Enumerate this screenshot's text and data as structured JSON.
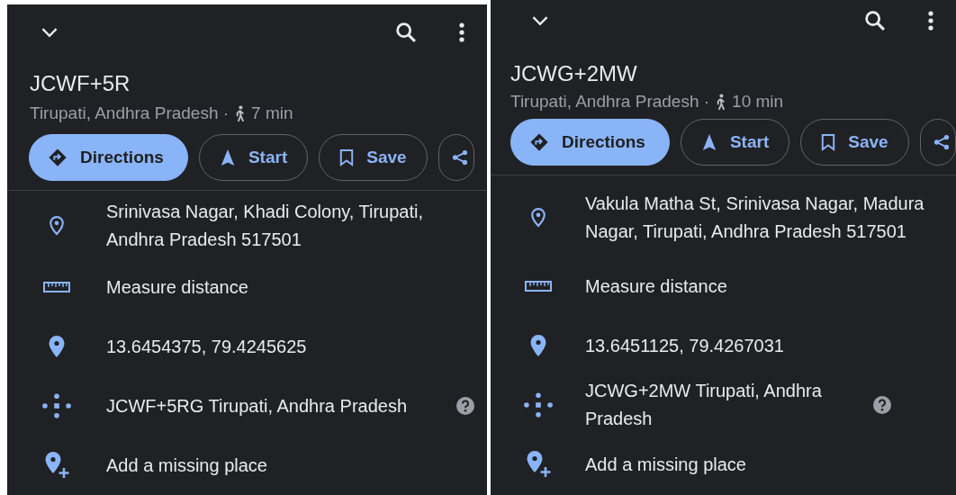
{
  "panels": [
    {
      "title": "JCWF+5R",
      "location": "Tirupati, Andhra Pradesh ·",
      "walk_time": "7 min",
      "buttons": [
        {
          "kind": "directions",
          "label": "Directions",
          "primary": true
        },
        {
          "kind": "start",
          "label": "Start",
          "primary": false
        },
        {
          "kind": "save",
          "label": "Save",
          "primary": false
        },
        {
          "kind": "share",
          "primary": false
        }
      ],
      "rows": [
        {
          "kind": "address",
          "text": "Srinivasa Nagar, Khadi Colony, Tirupati, Andhra Pradesh 517501",
          "help": false
        },
        {
          "kind": "measure",
          "text": "Measure distance",
          "help": false
        },
        {
          "kind": "coordinates",
          "text": "13.6454375, 79.4245625",
          "help": false
        },
        {
          "kind": "plus_code",
          "text": "JCWF+5RG Tirupati, Andhra Pradesh",
          "help": true
        },
        {
          "kind": "add_place",
          "text": "Add a missing place",
          "help": false
        }
      ]
    },
    {
      "title": "JCWG+2MW",
      "location": "Tirupati, Andhra Pradesh ·",
      "walk_time": "10 min",
      "buttons": [
        {
          "kind": "directions",
          "label": "Directions",
          "primary": true
        },
        {
          "kind": "start",
          "label": "Start",
          "primary": false
        },
        {
          "kind": "save",
          "label": "Save",
          "primary": false
        },
        {
          "kind": "share",
          "primary": false
        }
      ],
      "rows": [
        {
          "kind": "address",
          "text": "Vakula Matha St, Srinivasa Nagar, Madura Nagar, Tirupati, Andhra Pradesh 517501",
          "help": false
        },
        {
          "kind": "measure",
          "text": "Measure distance",
          "help": false
        },
        {
          "kind": "coordinates",
          "text": "13.6451125, 79.4267031",
          "help": false
        },
        {
          "kind": "plus_code",
          "text": "JCWG+2MW Tirupati, Andhra Pradesh",
          "help": true
        },
        {
          "kind": "add_place",
          "text": "Add a missing place",
          "help": false
        }
      ]
    }
  ]
}
